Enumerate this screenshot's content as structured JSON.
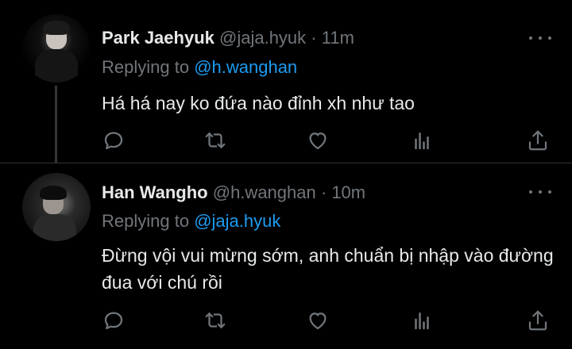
{
  "tweets": [
    {
      "name": "Park Jaehyuk",
      "handle": "@jaja.hyuk",
      "separator": "·",
      "time": "11m",
      "replying_prefix": "Replying to ",
      "replying_to": "@h.wanghan",
      "text": "Há há nay ko đứa nào đỉnh xh như tao"
    },
    {
      "name": "Han Wangho",
      "handle": "@h.wanghan",
      "separator": "·",
      "time": "10m",
      "replying_prefix": "Replying to ",
      "replying_to": "@jaja.hyuk",
      "text": "Đừng vội vui mừng sớm, anh chuẩn bị nhập vào đường đua với chú rồi"
    }
  ],
  "icons": [
    "more-icon",
    "reply-icon",
    "retweet-icon",
    "like-icon",
    "stats-icon",
    "share-icon"
  ],
  "colors": {
    "background": "#000000",
    "text": "#e7e9ea",
    "muted": "#71767b",
    "link": "#1d9bf0",
    "divider": "#2f3336"
  }
}
